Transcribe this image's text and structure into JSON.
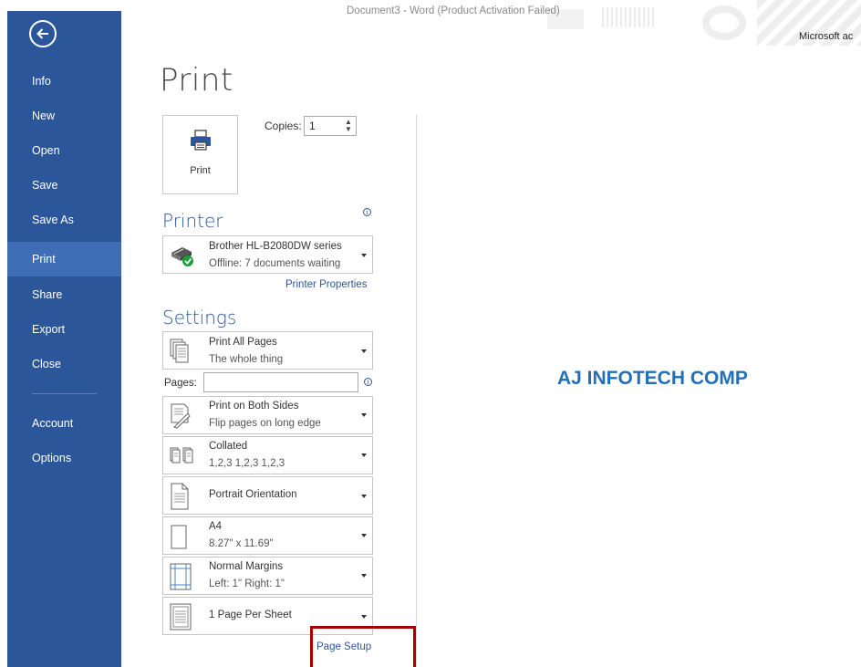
{
  "window": {
    "title": "Document3 - Word (Product Activation Failed)",
    "account": "Microsoft ac"
  },
  "sidebar": {
    "items": [
      {
        "label": "Info"
      },
      {
        "label": "New"
      },
      {
        "label": "Open"
      },
      {
        "label": "Save"
      },
      {
        "label": "Save As"
      },
      {
        "label": "Print",
        "active": true
      },
      {
        "label": "Share"
      },
      {
        "label": "Export"
      },
      {
        "label": "Close"
      },
      {
        "label": "Account"
      },
      {
        "label": "Options"
      }
    ]
  },
  "print": {
    "title": "Print",
    "button_label": "Print",
    "copies_label": "Copies:",
    "copies_value": "1"
  },
  "printer": {
    "heading": "Printer",
    "name": "Brother HL-B2080DW series",
    "status": "Offline: 7 documents waiting",
    "properties_link": "Printer Properties"
  },
  "settings": {
    "heading": "Settings",
    "pages_label": "Pages:",
    "pages_value": "",
    "range": {
      "title": "Print All Pages",
      "subtitle": "The whole thing"
    },
    "sides": {
      "title": "Print on Both Sides",
      "subtitle": "Flip pages on long edge"
    },
    "collation": {
      "title": "Collated",
      "subtitle": "1,2,3   1,2,3   1,2,3"
    },
    "orientation": {
      "title": "Portrait Orientation"
    },
    "paper": {
      "title": "A4",
      "subtitle": "8.27\" x 11.69\""
    },
    "margins": {
      "title": "Normal Margins",
      "subtitle": "Left:  1\"   Right:  1\""
    },
    "per_sheet": {
      "title": "1 Page Per Sheet"
    },
    "page_setup_link": "Page Setup"
  },
  "preview": {
    "text": "AJ INFOTECH COMP"
  },
  "colors": {
    "sidebar": "#2b579a",
    "sidebar_active": "#3e6db5",
    "accent": "#2b579a",
    "preview_text": "#2370b7",
    "highlight": "#a50000"
  }
}
